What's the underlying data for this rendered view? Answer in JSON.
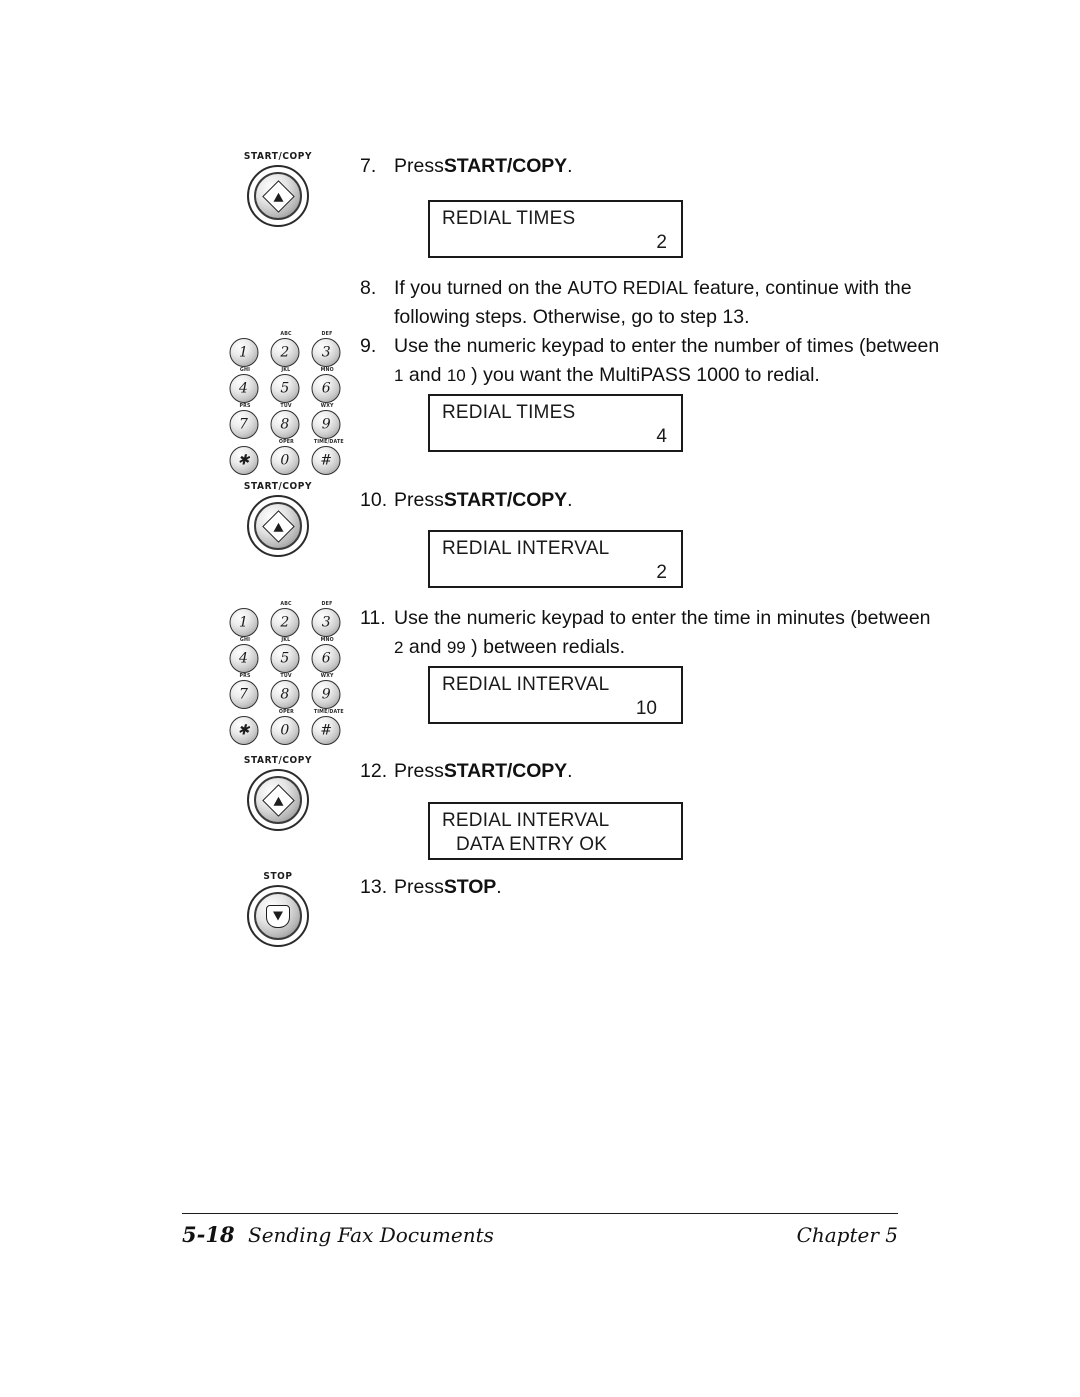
{
  "page": {
    "footer": {
      "page_number": "5-18",
      "section_title": "Sending Fax Documents",
      "chapter": "Chapter 5"
    }
  },
  "steps": [
    {
      "number": "7.",
      "press_label": "Press",
      "key": "START/COPY",
      "trailing": "."
    },
    {
      "number": "8.",
      "line1_a": "If you turned on the ",
      "line1_feature": "AUTO REDIAL",
      "line1_b": " feature, continue with the",
      "line2": "following steps. Otherwise, go to step 13."
    },
    {
      "number": "9.",
      "line1": "Use the numeric keypad to enter the number of times (between",
      "line2_a": "1",
      "line2_b": " and ",
      "line2_c": "10",
      "line2_d": " ) you want the MultiPASS 1000 to redial."
    },
    {
      "number": "10.",
      "press_label": "Press",
      "key": "START/COPY",
      "trailing": "."
    },
    {
      "number": "11.",
      "line1": "Use the numeric keypad to enter the time in minutes (between",
      "line2_a": "2",
      "line2_b": " and ",
      "line2_c": "99",
      "line2_d": " ) between redials."
    },
    {
      "number": "12.",
      "press_label": "Press",
      "key": "START/COPY",
      "trailing": "."
    },
    {
      "number": "13.",
      "press_label": "Press",
      "key": "STOP",
      "trailing": "."
    }
  ],
  "lcd_displays": [
    {
      "line1": "REDIAL TIMES",
      "value": "2",
      "line2": ""
    },
    {
      "line1": "REDIAL TIMES",
      "value": "4",
      "line2": ""
    },
    {
      "line1": "REDIAL INTERVAL",
      "value": "2",
      "line2": ""
    },
    {
      "line1": "REDIAL INTERVAL",
      "value": "10",
      "line2": ""
    },
    {
      "line1": "REDIAL INTERVAL",
      "value": "",
      "line2": "DATA ENTRY OK"
    }
  ],
  "buttons": [
    {
      "caption": "START/COPY",
      "glyph": "diamond-triangle-icon"
    },
    {
      "caption": "START/COPY",
      "glyph": "diamond-triangle-icon"
    },
    {
      "caption": "START/COPY",
      "glyph": "diamond-triangle-icon"
    },
    {
      "caption": "STOP",
      "glyph": "shield-triangle-icon"
    }
  ],
  "keypad": {
    "keys": [
      {
        "digit": "1",
        "letters": ""
      },
      {
        "digit": "2",
        "letters": "ABC"
      },
      {
        "digit": "3",
        "letters": "DEF"
      },
      {
        "digit": "4",
        "letters": "GHI"
      },
      {
        "digit": "5",
        "letters": "JKL"
      },
      {
        "digit": "6",
        "letters": "MNO"
      },
      {
        "digit": "7",
        "letters": "PRS"
      },
      {
        "digit": "8",
        "letters": "TUV"
      },
      {
        "digit": "9",
        "letters": "WXY"
      },
      {
        "digit": "✱",
        "letters": ""
      },
      {
        "digit": "0",
        "letters": "OPER"
      },
      {
        "digit": "#",
        "letters": "TIME/DATE"
      }
    ]
  }
}
